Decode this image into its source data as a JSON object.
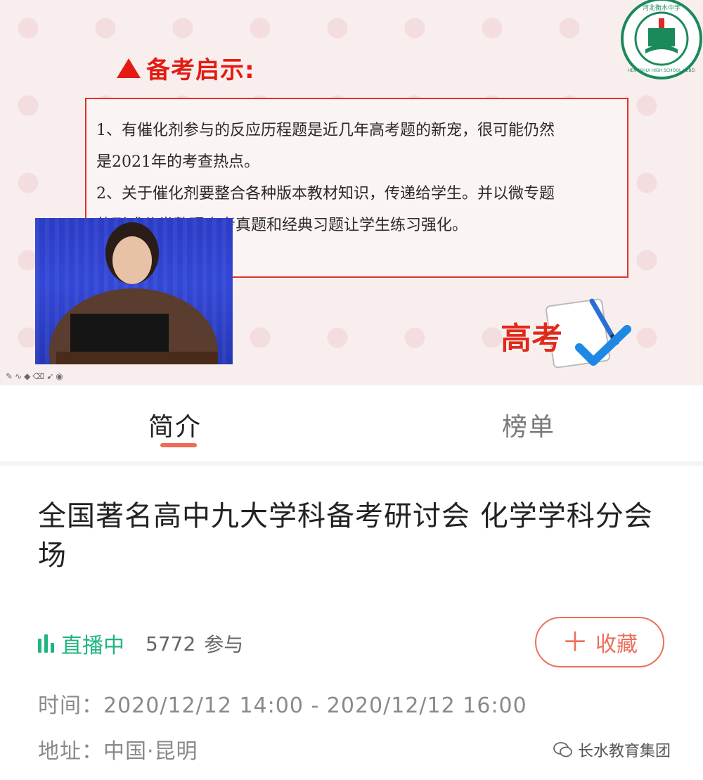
{
  "slide": {
    "heading": "备考启示:",
    "line1": "1、有催化剂参与的反应历程题是近几年高考题的新宠，很可能仍然",
    "line2": "是2021年的考查热点。",
    "line3": "2、关于催化剂要整合各种版本教材知识，传递给学生。并以微专题",
    "line4": "的形式分类整理高考真题和经典习题让学生练习强化。",
    "logo_text": "河北衡水中学",
    "logo_subtext": "HENGSHUI HIGH SCHOOL HEBEI",
    "badge_text": "高考"
  },
  "tabs": [
    {
      "label": "简介",
      "active": true
    },
    {
      "label": "榜单",
      "active": false
    }
  ],
  "event": {
    "title": "全国著名高中九大学科备考研讨会 化学学科分会场",
    "live_status": "直播中",
    "participants": "5772",
    "participants_label": "参与",
    "favorite_label": "收藏",
    "time_label": "时间：",
    "time_value": "2020/12/12 14:00 - 2020/12/12 16:00",
    "address_label": "地址：",
    "address_value": "中国·昆明"
  },
  "watermark": "长水教育集团",
  "colors": {
    "accent": "#ec6f5a",
    "live_green": "#1fb57f",
    "slide_red": "#e41b12",
    "logo_green": "#1a8a5a"
  }
}
